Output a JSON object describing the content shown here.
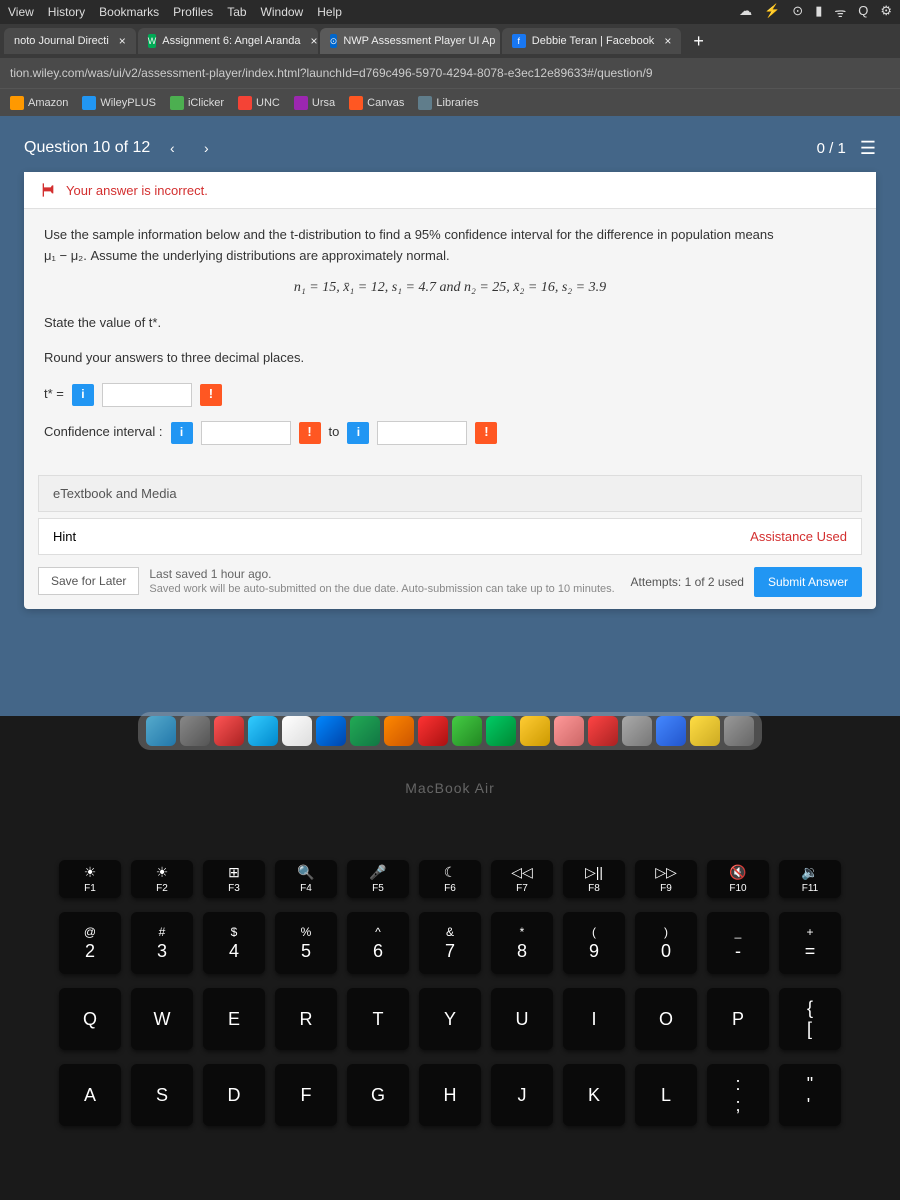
{
  "menubar": {
    "items": [
      "View",
      "History",
      "Bookmarks",
      "Profiles",
      "Tab",
      "Window",
      "Help"
    ],
    "right_icons": [
      "☁",
      "⚡",
      "⊙",
      "▮",
      "ᯤ",
      "Q",
      "⚙"
    ]
  },
  "tabs": [
    {
      "title": "noto Journal Directi",
      "fav": "—",
      "active": false
    },
    {
      "title": "Assignment 6: Angel Aranda",
      "fav": "W",
      "active": false
    },
    {
      "title": "NWP Assessment Player UI Ap",
      "fav": "⊙",
      "active": true
    },
    {
      "title": "Debbie Teran | Facebook",
      "fav": "f",
      "active": false
    }
  ],
  "newtab": "+",
  "url": "tion.wiley.com/was/ui/v2/assessment-player/index.html?launchId=d769c496-5970-4294-8078-e3ec12e89633#/question/9",
  "bookmarks": [
    {
      "label": "Amazon",
      "color": "#ff9900"
    },
    {
      "label": "WileyPLUS",
      "color": "#2196f3"
    },
    {
      "label": "iClicker",
      "color": "#4caf50"
    },
    {
      "label": "UNC",
      "color": "#f44336"
    },
    {
      "label": "Ursa",
      "color": "#9c27b0"
    },
    {
      "label": "Canvas",
      "color": "#ff5722"
    },
    {
      "label": "Libraries",
      "color": "#607d8b"
    }
  ],
  "question": {
    "label": "Question 10 of 12",
    "prev": "‹",
    "next": "›",
    "score": "0 / 1",
    "flag_text": "Your answer is incorrect.",
    "body_1": "Use the sample information below and the t-distribution to find a 95% confidence interval for the difference in population means",
    "body_2": "μ₁ − μ₂. Assume the underlying distributions are approximately normal.",
    "formula": "n₁ = 15, x̄₁ = 12, s₁ = 4.7 and n₂ = 25, x̄₂ = 16, s₂ = 3.9",
    "prompt_1": "State the value of t*.",
    "prompt_2": "Round your answers to three decimal places.",
    "tstar_label": "t* =",
    "ci_label": "Confidence interval :",
    "to": "to",
    "etextbook": "eTextbook and Media",
    "hint": "Hint",
    "assistance": "Assistance Used",
    "save_label": "Save for Later",
    "last_saved": "Last saved 1 hour ago.",
    "auto_note": "Saved work will be auto-submitted on the due date. Auto-submission can take up to 10 minutes.",
    "attempts": "Attempts: 1 of 2 used",
    "submit": "Submit Answer"
  },
  "macbook": "MacBook Air",
  "keyboard": {
    "fn_row": [
      {
        "sym": "☀",
        "label": "F1"
      },
      {
        "sym": "☀",
        "label": "F2"
      },
      {
        "sym": "⊞",
        "label": "F3"
      },
      {
        "sym": "🔍",
        "label": "F4"
      },
      {
        "sym": "🎤",
        "label": "F5"
      },
      {
        "sym": "☾",
        "label": "F6"
      },
      {
        "sym": "◁◁",
        "label": "F7"
      },
      {
        "sym": "▷||",
        "label": "F8"
      },
      {
        "sym": "▷▷",
        "label": "F9"
      },
      {
        "sym": "🔇",
        "label": "F10"
      },
      {
        "sym": "🔉",
        "label": "F11"
      }
    ],
    "num_row": [
      {
        "top": "@",
        "bot": "2"
      },
      {
        "top": "#",
        "bot": "3"
      },
      {
        "top": "$",
        "bot": "4"
      },
      {
        "top": "%",
        "bot": "5"
      },
      {
        "top": "^",
        "bot": "6"
      },
      {
        "top": "&",
        "bot": "7"
      },
      {
        "top": "*",
        "bot": "8"
      },
      {
        "top": "(",
        "bot": "9"
      },
      {
        "top": ")",
        "bot": "0"
      },
      {
        "top": "_",
        "bot": "-"
      },
      {
        "top": "+",
        "bot": "="
      }
    ],
    "row_q": [
      "Q",
      "W",
      "E",
      "R",
      "T",
      "Y",
      "U",
      "I",
      "O",
      "P",
      "{\n["
    ],
    "row_a": [
      "A",
      "S",
      "D",
      "F",
      "G",
      "H",
      "J",
      "K",
      "L",
      ":\n;",
      "\"\n'"
    ]
  }
}
